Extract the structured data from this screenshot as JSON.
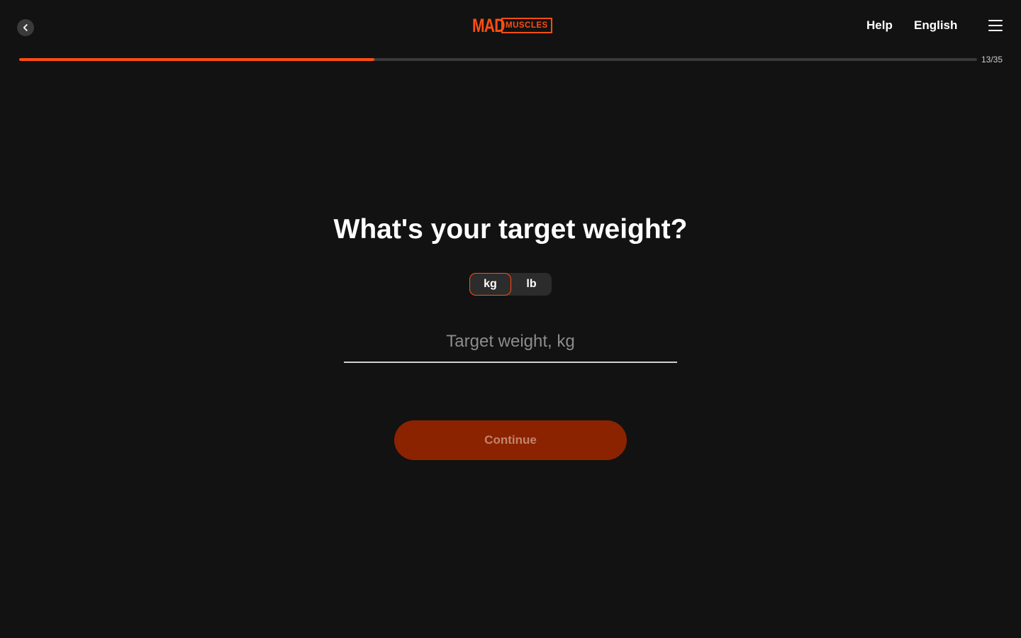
{
  "header": {
    "logo": {
      "mad": "MAD",
      "muscles": "MUSCLES"
    },
    "help_label": "Help",
    "language_label": "English"
  },
  "progress": {
    "current": 13,
    "total": 35,
    "label": "13/35",
    "fraction": 0.371
  },
  "question": {
    "title": "What's your target weight?"
  },
  "units": {
    "options": [
      "kg",
      "lb"
    ],
    "selected": "kg"
  },
  "weight_field": {
    "value": "",
    "placeholder": "Target weight, kg"
  },
  "continue_label": "Continue",
  "colors": {
    "accent": "#ff4e12",
    "background": "#121212",
    "button_disabled": "#8b2300"
  }
}
